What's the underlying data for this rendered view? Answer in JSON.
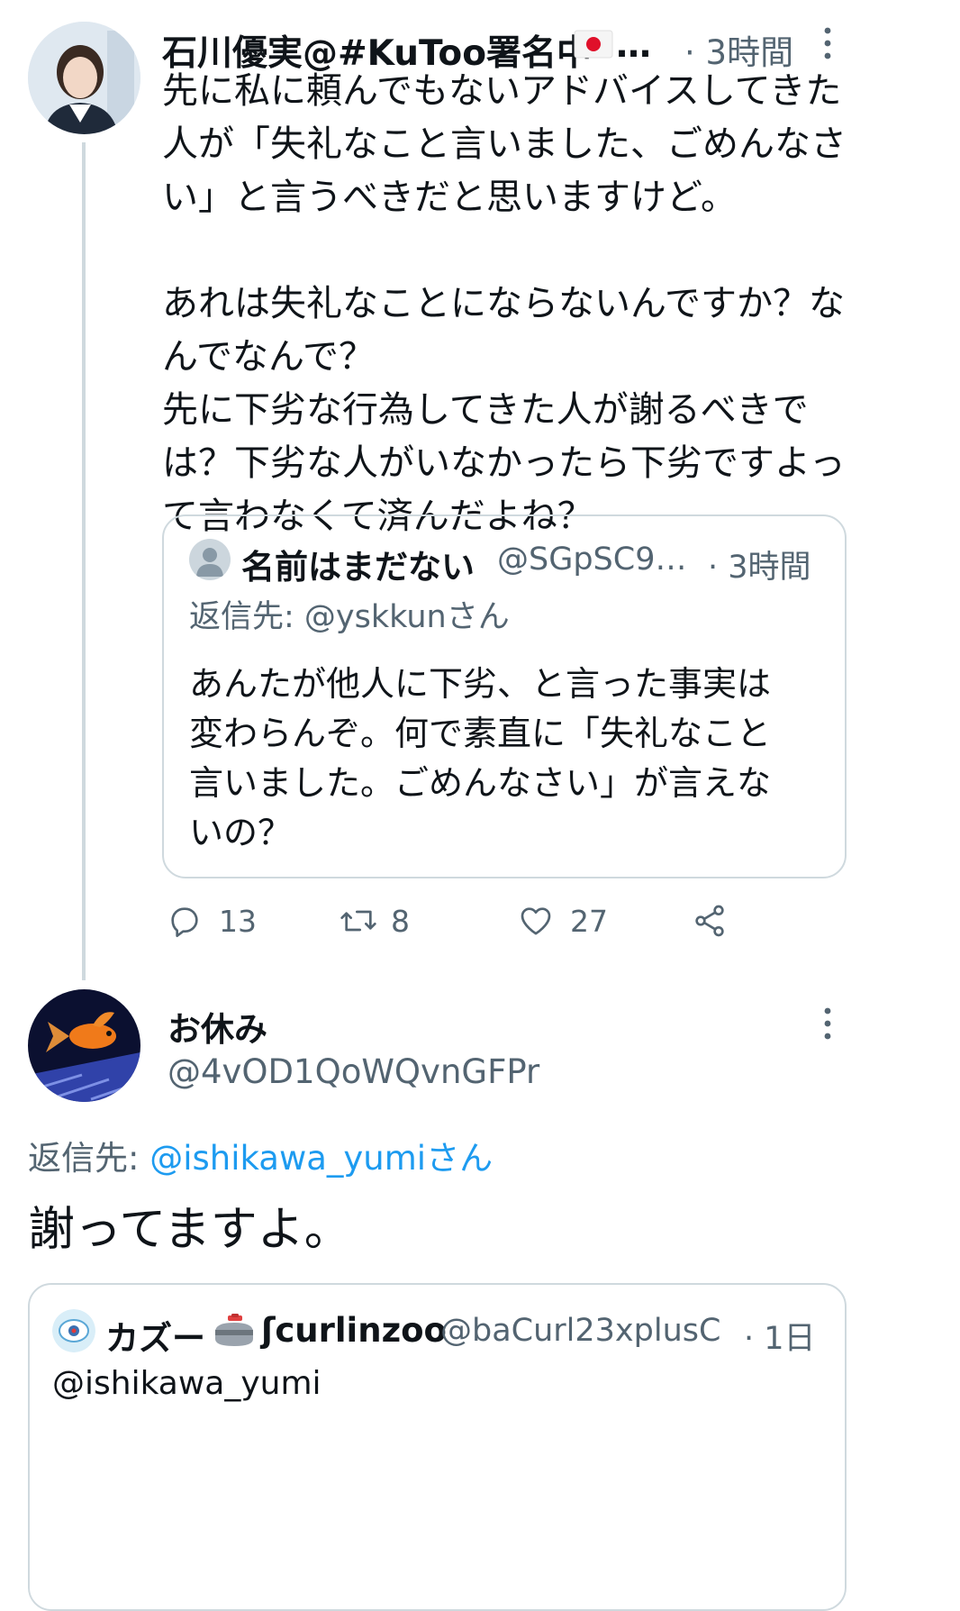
{
  "tweet1": {
    "name": "石川優実@#KuToo署名中",
    "flag": "flag-japan-icon",
    "ellipsis": "…",
    "time": "· 3時間",
    "body": "先に私に頼んでもないアドバイスしてきた\n人が「失礼なこと言いました、ごめんなさ\nい」と言うべきだと思いますけど。\n\nあれは失礼なことにならないんですか？な\nんでなんで？\n先に下劣な行為してきた人が謝るべきで\nは？下劣な人がいなかったら下劣ですよっ\nて言わなくて済んだよね？",
    "quote": {
      "name": "名前はまだない",
      "handle": "@SGpSC9…",
      "time": "· 3時間",
      "reply_label": "返信先: @yskkunさん",
      "body": "あんたが他人に下劣、と言った事実は\n変わらんぞ。何で素直に「失礼なこと\n言いました。ごめんなさい」が言えな\nいの？"
    },
    "actions": {
      "replies": "13",
      "retweets": "8",
      "likes": "27"
    }
  },
  "tweet2": {
    "name": "お休み",
    "handle": "@4vOD1QoWQvnGFPr",
    "reply_prefix": "返信先: ",
    "reply_to": "@ishikawa_yumiさん",
    "body": "謝ってますよ。",
    "quote": {
      "name": "カズー",
      "name2": "ʃcurlinzoo",
      "handle": "@baCurl23xplusC",
      "time": "· 1日",
      "body": "@ishikawa_yumi"
    }
  },
  "colors": {
    "text": "#0f1419",
    "muted": "#536471",
    "link": "#1d9bf0",
    "border": "#cfd9de"
  }
}
